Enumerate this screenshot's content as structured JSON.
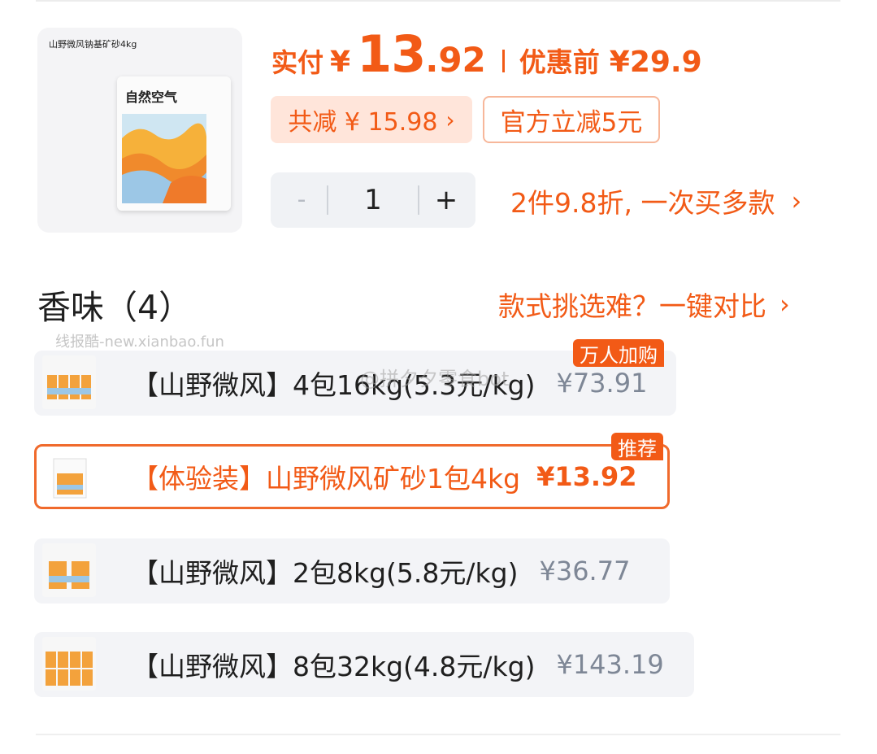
{
  "product": {
    "image_caption": "山野微风钠基矿砂4kg",
    "bag_title": "自然空气"
  },
  "price": {
    "label": "实付",
    "currency": "¥",
    "integer": "13",
    "decimal": ".92",
    "original_label": "优惠前",
    "original_price": "¥29.9"
  },
  "discounts": {
    "total_reduction": "共减 ¥ 15.98",
    "official": "官方立减5元"
  },
  "quantity": {
    "minus": "-",
    "value": "1",
    "plus": "+"
  },
  "promo": {
    "text": "2件9.8折, 一次买多款"
  },
  "section": {
    "title": "香味（4）",
    "compare": "款式挑选难？一键对比"
  },
  "watermarks": {
    "top": "线报酷-new.xianbao.fun",
    "middle": "@拼夕夕零食bot"
  },
  "options": [
    {
      "label": "【山野微风】4包16kg(5.3元/kg)",
      "price": "¥73.91",
      "badge": "万人加购",
      "selected": false
    },
    {
      "label": "【体验装】山野微风矿砂1包4kg",
      "price": "¥13.92",
      "badge": "推荐",
      "selected": true
    },
    {
      "label": "【山野微风】2包8kg(5.8元/kg)",
      "price": "¥36.77",
      "badge": "",
      "selected": false
    },
    {
      "label": "【山野微风】8包32kg(4.8元/kg)",
      "price": "¥143.19",
      "badge": "",
      "selected": false
    }
  ],
  "icons": {
    "chevron": "chevron-right-icon"
  },
  "colors": {
    "accent": "#f25a16",
    "accent_light_bg": "#ffe5da",
    "option_bg": "#f3f4f7",
    "muted_price": "#7e8796"
  }
}
